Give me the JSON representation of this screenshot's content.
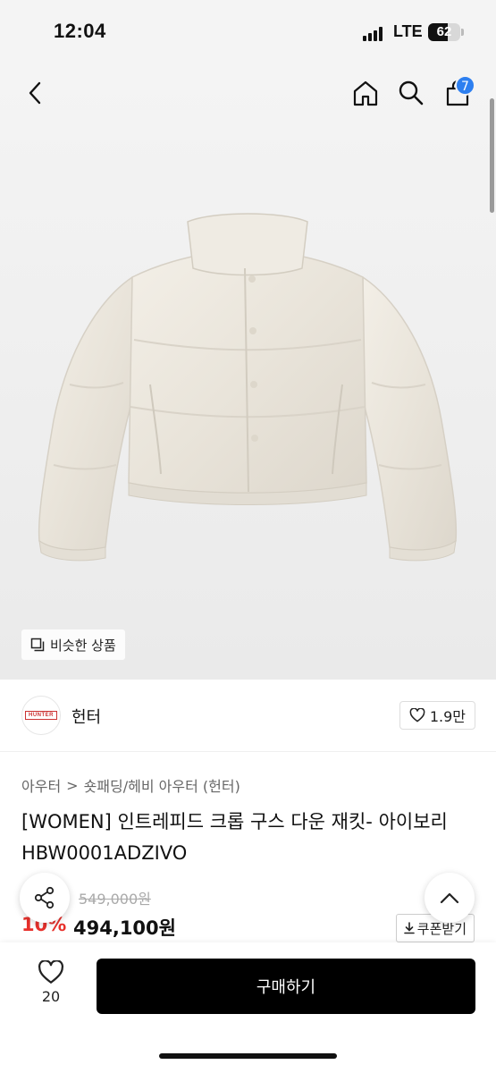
{
  "status": {
    "time": "12:04",
    "network": "LTE",
    "battery": "62",
    "battery_level": 0.62
  },
  "header": {
    "cart_count": "7"
  },
  "hero": {
    "similar_label": "비슷한 상품"
  },
  "brand": {
    "logo_text": "HUNTER",
    "name": "헌터",
    "likes": "1.9만"
  },
  "breadcrumb": {
    "level1": "아우터",
    "separator": ">",
    "level2": "숏패딩/헤비 아우터 (헌터)"
  },
  "product": {
    "title": "[WOMEN] 인트레피드 크롭 구스 다운 재킷- 아이보리 HBW0001ADZIVO",
    "original_price": "549,000원",
    "discount_rate": "10%",
    "sale_price": "494,100원",
    "coupon_label": "쿠폰받기"
  },
  "bottom": {
    "wish_count": "20",
    "buy_label": "구매하기"
  },
  "colors": {
    "accent_blue": "#2d7ff0",
    "discount_red": "#e8312c",
    "buy_button": "#000000"
  },
  "icons": [
    "back-icon",
    "home-icon",
    "search-icon",
    "cart-icon",
    "similar-icon",
    "heart-icon",
    "share-icon",
    "chevron-up-icon",
    "download-icon"
  ]
}
